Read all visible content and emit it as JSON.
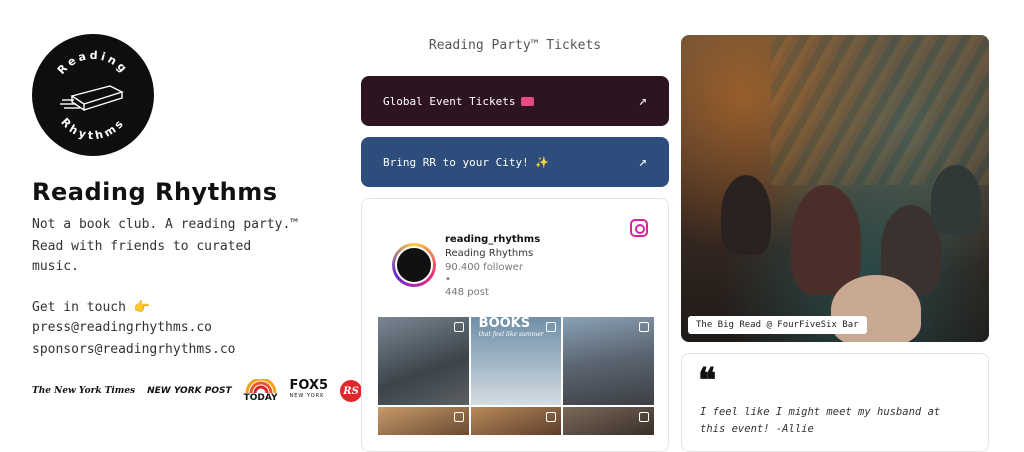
{
  "brand": {
    "logo_top_text": "Reading",
    "logo_bottom_text": "Rhythms",
    "name": "Reading Rhythms",
    "tagline": "Not a book club. A reading party.™",
    "description": "Read with friends to curated music."
  },
  "contact": {
    "heading": "Get in touch 👉",
    "press_email": "press@readingrhythms.co",
    "sponsors_email": "sponsors@readingrhythms.co"
  },
  "press_logos": {
    "nyt": "The New York Times",
    "nypost": "NEW YORK POST",
    "today": "TODAY",
    "fox_main": "FOX5",
    "fox_sub": "NEW YORK",
    "rs": "RS"
  },
  "tickets": {
    "title": "Reading Party™ Tickets",
    "global_label": "Global Event Tickets",
    "city_label": "Bring RR to your City! ✨",
    "arrow": "↗"
  },
  "instagram": {
    "handle": "reading_rhythms",
    "name": "Reading Rhythms",
    "followers": "90.400 follower",
    "dot": "•",
    "posts": "448 post",
    "tile_headline": "BOOKS",
    "tile_subtext": "that feel like summer"
  },
  "photo": {
    "caption": "The Big Read @ FourFiveSix Bar"
  },
  "quote": {
    "mark": "❝",
    "text": "I feel like I might meet my husband at this event! -Allie"
  },
  "colors": {
    "global_button": "#2d1421",
    "city_button": "#2d4d7c",
    "instagram_accent": "#d6249f",
    "rs_red": "#e3262a"
  }
}
